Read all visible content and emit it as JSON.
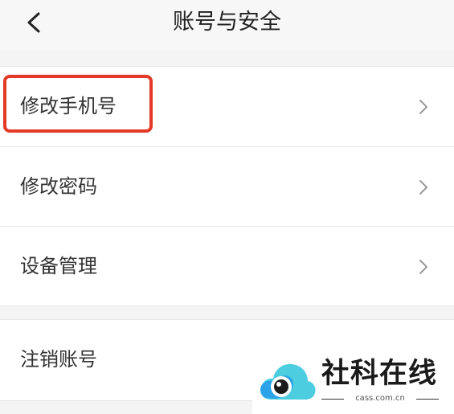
{
  "header": {
    "title": "账号与安全",
    "back_icon": "chevron-left-icon"
  },
  "settings": {
    "items": [
      {
        "label": "修改手机号",
        "icon": "chevron-right-icon"
      },
      {
        "label": "修改密码",
        "icon": "chevron-right-icon"
      },
      {
        "label": "设备管理",
        "icon": "chevron-right-icon"
      }
    ],
    "cancel_account": {
      "label": "注销账号"
    }
  },
  "watermark": {
    "name": "社科在线",
    "domain": "cass.com.cn",
    "logo": "cloud-eye-logo"
  },
  "colors": {
    "highlight": "#e23a27",
    "logo_blue": "#2aa3e8",
    "logo_cyan": "#4ccde0"
  }
}
